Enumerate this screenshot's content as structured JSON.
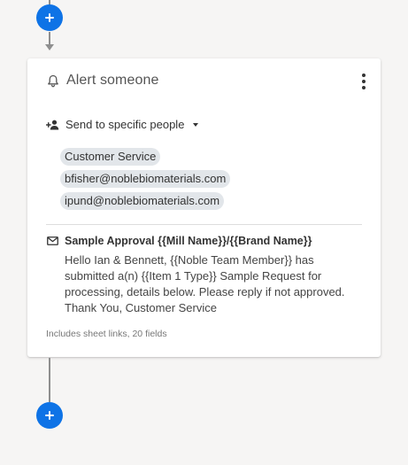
{
  "flow": {
    "add_step_top_label": "+",
    "add_step_bottom_label": "+"
  },
  "card": {
    "title": "Alert someone",
    "title_icon": "bell-icon",
    "menu_icon": "more-vertical-icon",
    "recipient_mode": {
      "label": "Send to specific people",
      "icon": "add-person-icon",
      "dropdown_icon": "caret-down-icon"
    },
    "recipients": [
      "Customer Service",
      "bfisher@noblebiomaterials.com",
      "ipund@noblebiomaterials.com"
    ],
    "email": {
      "icon": "mail-icon",
      "subject": "Sample Approval {{Mill Name}}/{{Brand Name}}",
      "body": "Hello Ian & Bennett, {{Noble Team Member}} has submitted a(n) {{Item 1 Type}} Sample Request for processing, details below. Please reply if not approved. Thank You, Customer Service"
    },
    "footer": "Includes sheet links, 20 fields"
  },
  "colors": {
    "accent": "#0e73e6",
    "connector": "#8f8f8f",
    "chip_bg": "#e2e6ea",
    "page_bg": "#f6f5f4"
  }
}
